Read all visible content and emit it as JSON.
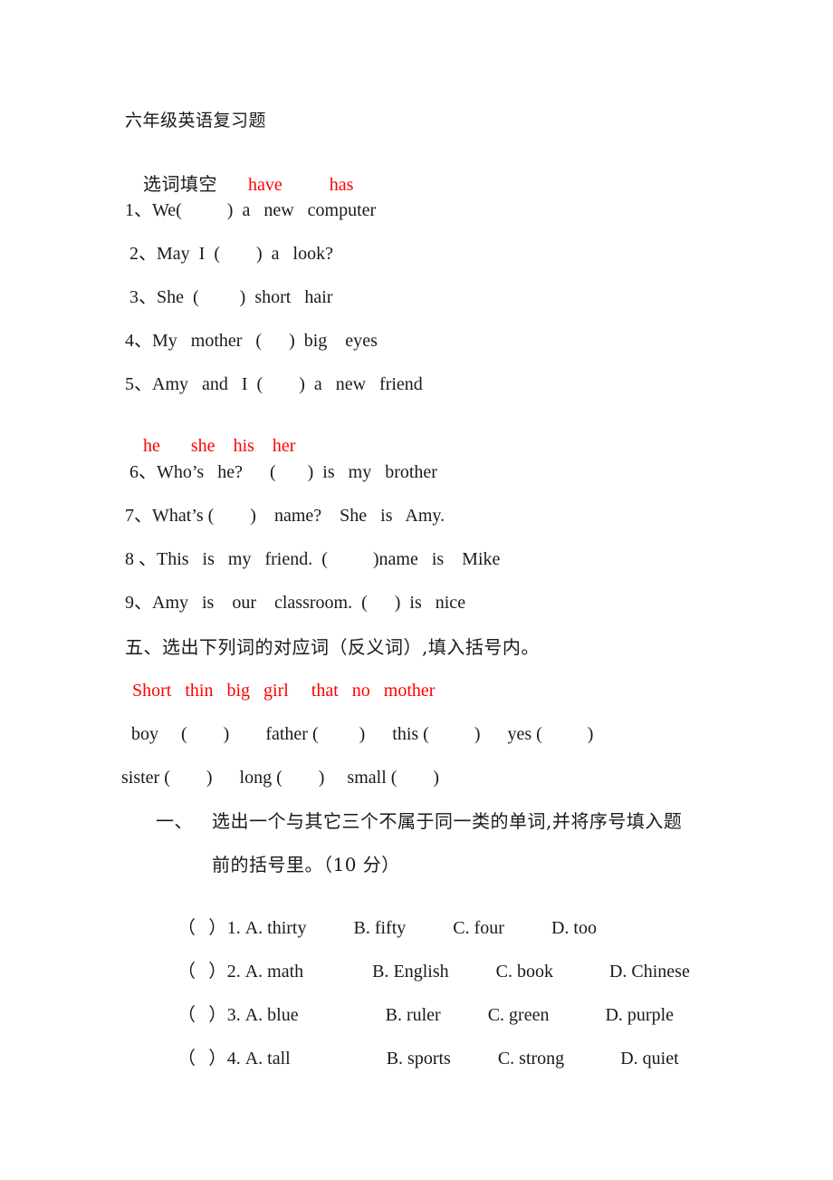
{
  "document": {
    "title": "六年级英语复习题",
    "section_fill_in": {
      "heading_cn": "选词填空",
      "word_bank_1": "have",
      "word_bank_1b": "has",
      "items": [
        "1、We(          )  a   new   computer",
        " 2、May  I  (        )  a   look?",
        " 3、She  (         )  short   hair",
        "4、My   mother   (      )  big    eyes",
        "5、Amy   and   I  (        )  a   new   friend"
      ],
      "word_bank_2": "he",
      "word_bank_2b": "she",
      "word_bank_2c": "his",
      "word_bank_2d": "her",
      "items2": [
        " 6、Who’s   he?      (       )  is   my   brother",
        "7、What’s (        )    name?    She   is   Amy.",
        "8 、This   is   my   friend.  (          )name   is    Mike",
        "9、Amy   is    our    classroom.  (      )  is   nice"
      ]
    },
    "section_five": {
      "heading": "五、选出下列词的对应词（反义词）,填入括号内。",
      "word_bank": "Short   thin   big   girl     that   no   mother",
      "pairs_line_1": " boy     (        )        father (         )      this (          )      yes (          )",
      "pairs_line_2": "sister (        )      long (        )     small (        )"
    },
    "section_one": {
      "number": "一、",
      "heading_part1": "选出一个与其它三个不属于同一类的单词,并将序号填入题",
      "heading_part2": "前的括号里。（10 分）",
      "questions": [
        {
          "bracket": "（  ）",
          "num": "1. ",
          "a": "A. thirty",
          "b": "B. fifty",
          "c": "C. four",
          "d": "D. too"
        },
        {
          "bracket": "（  ）",
          "num": "2. ",
          "a": "A. math",
          "b": "B. English",
          "c": "C. book",
          "d": "D. Chinese"
        },
        {
          "bracket": "（  ）",
          "num": "3. ",
          "a": "A. blue",
          "b": "B. ruler",
          "c": "C. green",
          "d": "D. purple"
        },
        {
          "bracket": "（  ）",
          "num": "4. ",
          "a": "A. tall",
          "b": "B. sports",
          "c": "C. strong",
          "d": "D. quiet"
        }
      ]
    },
    "colors": {
      "accent_red": "#ff0000",
      "text": "#1a1a1a",
      "background": "#ffffff"
    }
  }
}
